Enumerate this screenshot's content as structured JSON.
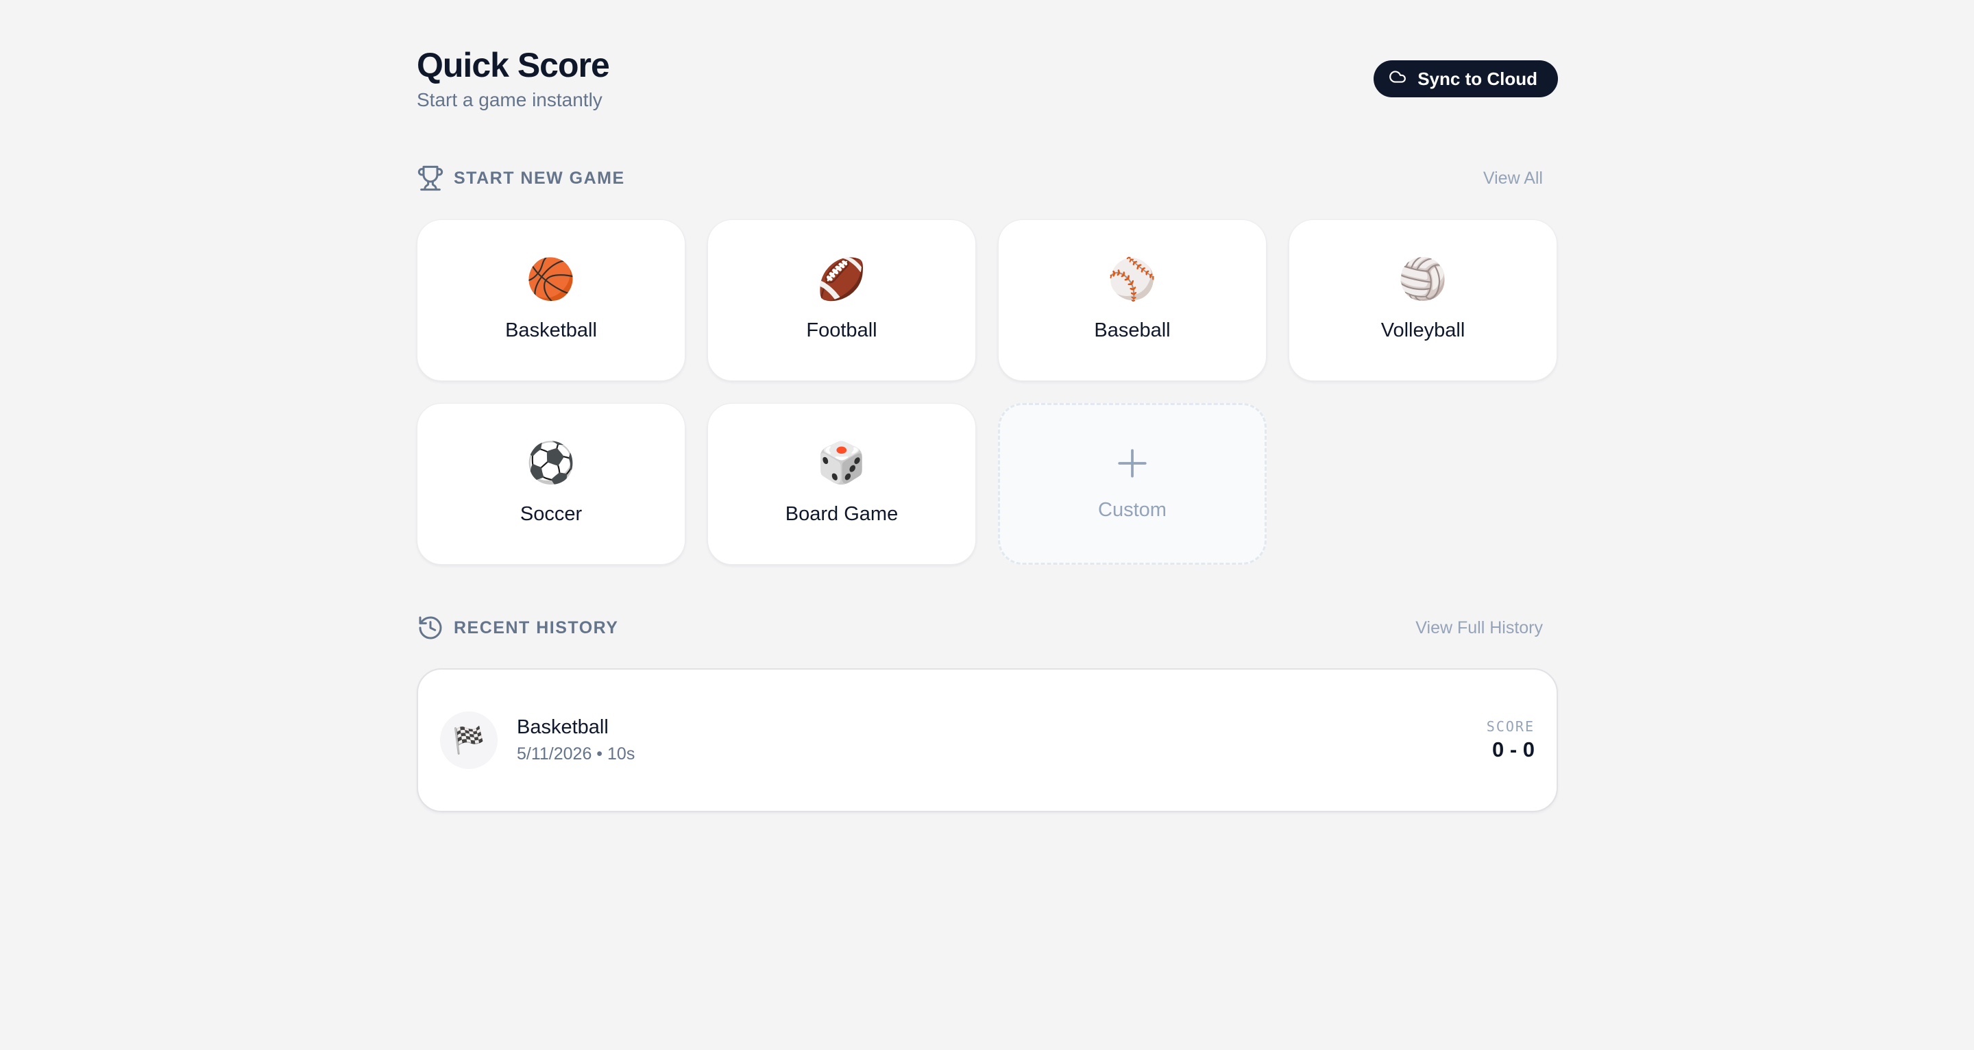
{
  "header": {
    "title": "Quick Score",
    "subtitle": "Start a game instantly",
    "sync_label": "Sync to Cloud",
    "sync_icon": "cloud-icon"
  },
  "new_game": {
    "icon": "trophy-icon",
    "label": "START NEW GAME",
    "link": "View All",
    "games": [
      {
        "label": "Basketball",
        "emoji": "🏀"
      },
      {
        "label": "Football",
        "emoji": "🏈"
      },
      {
        "label": "Baseball",
        "emoji": "⚾"
      },
      {
        "label": "Volleyball",
        "emoji": "🏐"
      },
      {
        "label": "Soccer",
        "emoji": "⚽"
      },
      {
        "label": "Board Game",
        "emoji": "🎲"
      }
    ],
    "custom_label": "Custom"
  },
  "history": {
    "icon": "history-icon",
    "label": "RECENT HISTORY",
    "link": "View Full History",
    "items": [
      {
        "title": "Basketball",
        "meta": "5/11/2026 • 10s",
        "emoji": "🏁",
        "score_label": "SCORE",
        "score": "0 - 0"
      }
    ]
  },
  "colors": {
    "background": "#f4f4f5",
    "primary": "#0f172a",
    "muted": "#64748b",
    "subtle": "#94a3b8"
  }
}
